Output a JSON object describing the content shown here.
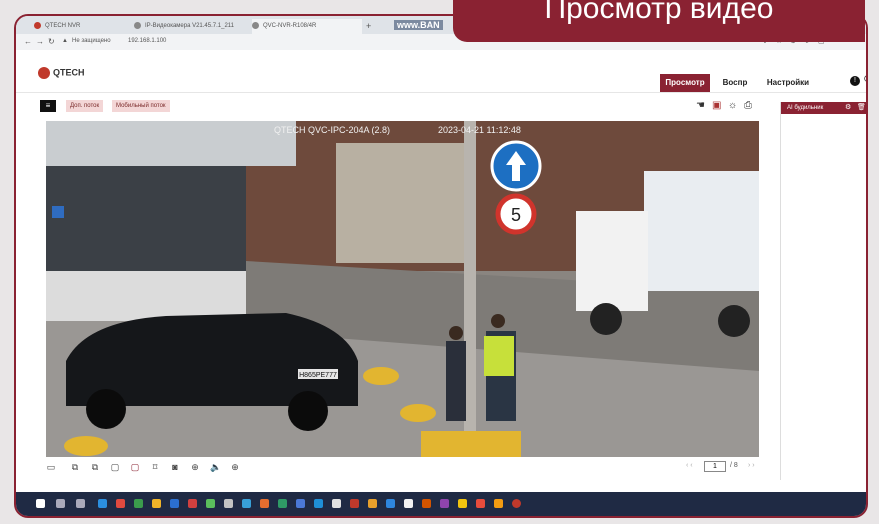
{
  "banner": {
    "title": "Просмотр видео"
  },
  "browser": {
    "tabs": [
      {
        "label": "QTECH NVR"
      },
      {
        "label": "IP-Видеокамера V21.45.7.1_211"
      },
      {
        "label": "QVC-NVR-R108/4R"
      }
    ],
    "address": {
      "warning": "Не защищено",
      "url": "192.168.1.100"
    },
    "watermark": "www.BAN"
  },
  "app": {
    "logo": "QTECH",
    "nav": {
      "live": "Просмотр",
      "playback": "Воспр",
      "settings": "Настройки"
    },
    "toolbar": {
      "extra_stream": "Доп. поток",
      "mobile_stream": "Мобильный поток"
    },
    "side": {
      "header": "AI будильник"
    },
    "video": {
      "camera_name": "QTECH QVC-IPC-204A (2.8)",
      "timestamp": "2023-04-21 11:12:48",
      "speed_sign": "5",
      "plate": "Н865РЕ777"
    },
    "pager": {
      "current": "1",
      "total": "/ 8"
    }
  },
  "colors": {
    "accent": "#8a2232",
    "taskbar": "#1f2a44"
  }
}
